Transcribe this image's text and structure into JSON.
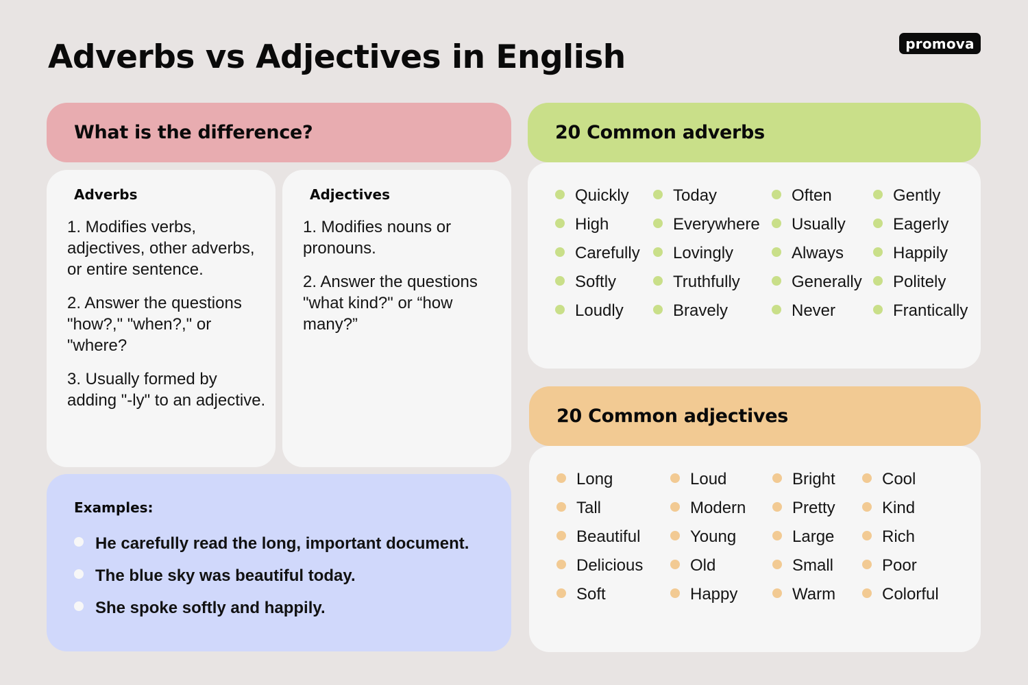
{
  "title": "Adverbs vs Adjectives in English",
  "logo": "promova",
  "difference": {
    "header": "What is the difference?",
    "adverbs": {
      "title": "Adverbs",
      "points": [
        "1. Modifies verbs, adjectives, other adverbs, or entire sentence.",
        "2. Answer the questions \"how?,\" \"when?,\" or \"where?",
        "3. Usually formed by adding \"-ly\" to an adjective."
      ]
    },
    "adjectives": {
      "title": "Adjectives",
      "points": [
        "1. Modifies nouns or pronouns.",
        "2. Answer the questions \"what kind?\" or “how many?”"
      ]
    }
  },
  "examples": {
    "title": "Examples:",
    "items": [
      "He carefully read the long, important document.",
      "The blue sky was beautiful today.",
      "She spoke softly and happily."
    ]
  },
  "common_adverbs": {
    "header": "20 Common adverbs",
    "bullet_color": "#c9df89",
    "columns": [
      [
        "Quickly",
        "High",
        "Carefully",
        "Softly",
        "Loudly"
      ],
      [
        "Today",
        "Everywhere",
        "Lovingly",
        "Truthfully",
        "Bravely"
      ],
      [
        "Often",
        "Usually",
        "Always",
        "Generally",
        "Never"
      ],
      [
        "Gently",
        "Eagerly",
        "Happily",
        "Politely",
        "Frantically"
      ]
    ]
  },
  "common_adjectives": {
    "header": "20 Common adjectives",
    "bullet_color": "#f2ca93",
    "columns": [
      [
        "Long",
        "Tall",
        "Beautiful",
        "Delicious",
        "Soft"
      ],
      [
        "Loud",
        "Modern",
        "Young",
        "Old",
        "Happy"
      ],
      [
        "Bright",
        "Pretty",
        "Large",
        "Small",
        "Warm"
      ],
      [
        "Cool",
        "Kind",
        "Rich",
        "Poor",
        "Colorful"
      ]
    ]
  },
  "colors": {
    "background": "#e8e4e3",
    "difference_header": "#e8acb0",
    "adverbs_header": "#c9df89",
    "adjectives_header": "#f2ca93",
    "examples_bg": "#d0d8fb",
    "card_bg": "#f6f6f6"
  }
}
